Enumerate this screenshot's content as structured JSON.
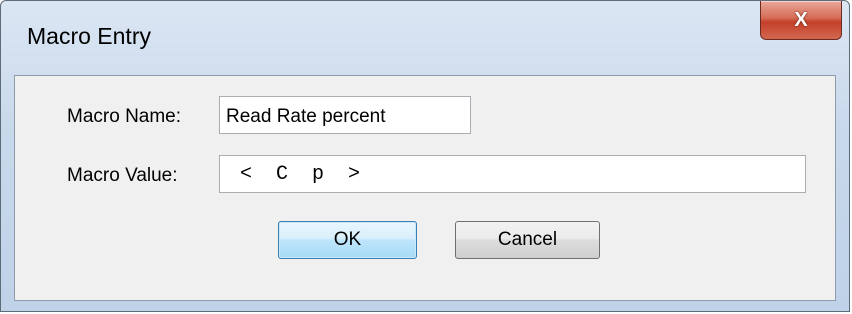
{
  "window": {
    "title": "Macro Entry",
    "close_label": "X"
  },
  "form": {
    "name_label": "Macro Name:",
    "name_value": "Read Rate percent",
    "value_label": "Macro Value:",
    "value_value": "<  C  p  >"
  },
  "buttons": {
    "ok_label": "OK",
    "cancel_label": "Cancel"
  },
  "colors": {
    "title_bar": "#c9d9ec",
    "close_button": "#c4402a",
    "dialog_body": "#f0f0f0",
    "default_button_border": "#3c7fb1"
  }
}
